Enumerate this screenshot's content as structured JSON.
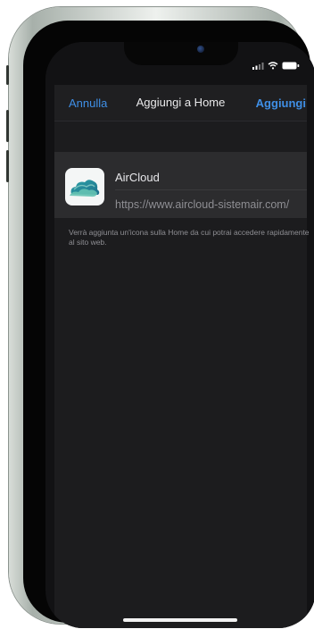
{
  "navigation": {
    "cancel_label": "Annulla",
    "title": "Aggiungi a Home",
    "add_label": "Aggiungi"
  },
  "shortcut": {
    "name": "AirCloud",
    "url": "https://www.aircloud-sistemair.com/",
    "icon": "aircloud-logo-icon"
  },
  "footer": {
    "text": "Verrà aggiunta un'icona sulla Home da cui potrai accedere rapidamente al sito web."
  },
  "status_bar": {
    "icons": [
      "cellular-signal-icon",
      "wifi-icon",
      "battery-icon"
    ]
  },
  "colors": {
    "accent": "#3f8fe6",
    "background": "#1c1c1e",
    "grouped_cell": "#2c2c2e",
    "secondary_text": "#8e8e93"
  }
}
